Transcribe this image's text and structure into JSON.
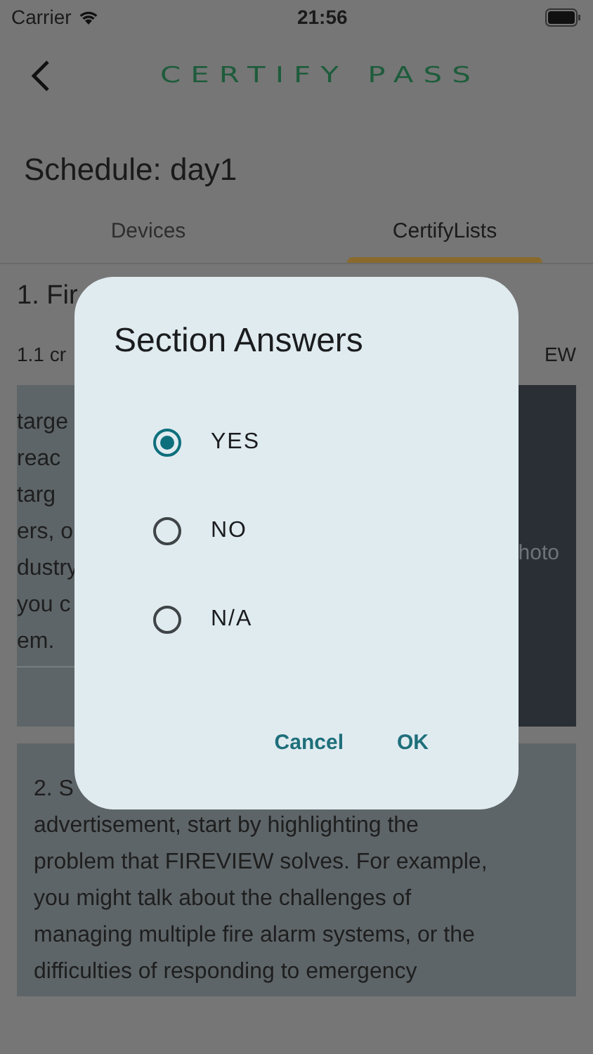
{
  "status_bar": {
    "carrier": "Carrier",
    "time": "21:56"
  },
  "header": {
    "logo": "CERTIFY PASS"
  },
  "title": "Schedule: day1",
  "tabs": [
    {
      "label": "Devices",
      "selected": false
    },
    {
      "label": "CertifyLists",
      "selected": true
    }
  ],
  "section_heading": "1. Fir",
  "item": {
    "label": "1.1 cr",
    "label_end": "EW"
  },
  "card_lines": [
    "targe",
    "reac",
    "targ",
    "ers, o",
    "dustry",
    "you c",
    "em."
  ],
  "photo_label": "hoto",
  "card2": {
    "first": "2. S",
    "lines": [
      "advertisement, start by highlighting the",
      "problem that FIREVIEW solves. For example,",
      "you might talk about the challenges of",
      "managing multiple fire alarm systems, or the",
      "difficulties of responding to emergency"
    ]
  },
  "dialog": {
    "title": "Section Answers",
    "options": [
      {
        "label": "YES",
        "selected": true
      },
      {
        "label": "NO",
        "selected": false
      },
      {
        "label": "N/A",
        "selected": false
      }
    ],
    "buttons": [
      "Cancel",
      "OK"
    ]
  }
}
